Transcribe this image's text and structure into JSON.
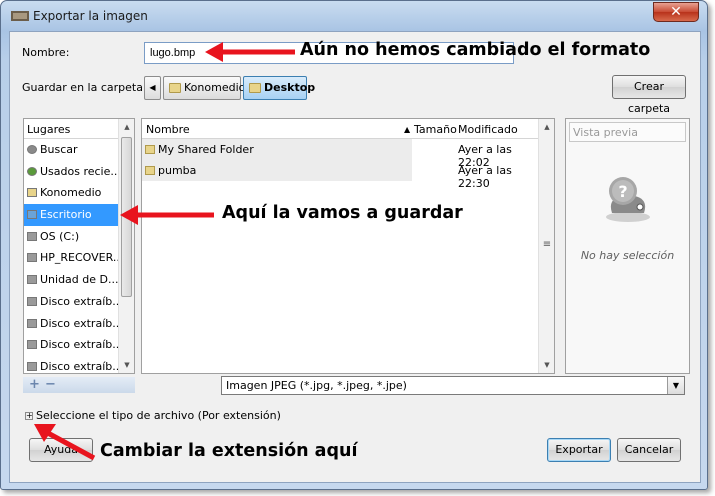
{
  "window": {
    "title": "Exportar la imagen",
    "close_glyph": "✕"
  },
  "name_label": "Nombre:",
  "name_label_key": "N",
  "filename": "lugo.bmp",
  "folder_label": "Guardar en la carpeta:",
  "breadcrumbs": [
    {
      "label": "Konomedio",
      "active": false
    },
    {
      "label": "Desktop",
      "active": true
    }
  ],
  "create_folder_button": "Crear carpeta",
  "places": {
    "header": "Lugares",
    "items": [
      {
        "label": "Buscar",
        "icon": "search-icon"
      },
      {
        "label": "Usados recie...",
        "icon": "recent-icon"
      },
      {
        "label": "Konomedio",
        "icon": "folder-icon"
      },
      {
        "label": "Escritorio",
        "icon": "desktop-icon",
        "selected": true
      },
      {
        "label": "OS (C:)",
        "icon": "drive-icon"
      },
      {
        "label": "HP_RECOVER...",
        "icon": "drive-icon"
      },
      {
        "label": "Unidad de D...",
        "icon": "drive-icon"
      },
      {
        "label": "Disco extraíb...",
        "icon": "drive-icon"
      },
      {
        "label": "Disco extraíb...",
        "icon": "drive-icon"
      },
      {
        "label": "Disco extraíb...",
        "icon": "drive-icon"
      },
      {
        "label": "Disco extraíb...",
        "icon": "drive-icon"
      }
    ]
  },
  "files": {
    "columns": [
      "Nombre",
      "Tamaño",
      "Modificado"
    ],
    "rows": [
      {
        "name": "My Shared Folder",
        "modified": "Ayer a las 22:02"
      },
      {
        "name": "pumba",
        "modified": "Ayer a las 22:30"
      }
    ]
  },
  "preview": {
    "title": "Vista previa",
    "empty_text": "No hay selección"
  },
  "file_type": "Imagen JPEG (*.jpg, *.jpeg, *.jpe)",
  "expander_label": "Seleccione el tipo de archivo (Por extensión)",
  "buttons": {
    "help": "Ayuda",
    "export": "Exportar",
    "cancel": "Cancelar"
  },
  "annotations": {
    "format": "Aún no hemos cambiado el formato",
    "save_here": "Aquí la vamos a guardar",
    "change_ext": "Cambiar la extensión aquí"
  },
  "colors": {
    "selection": "#3399ff",
    "arrow": "#e8141e"
  }
}
